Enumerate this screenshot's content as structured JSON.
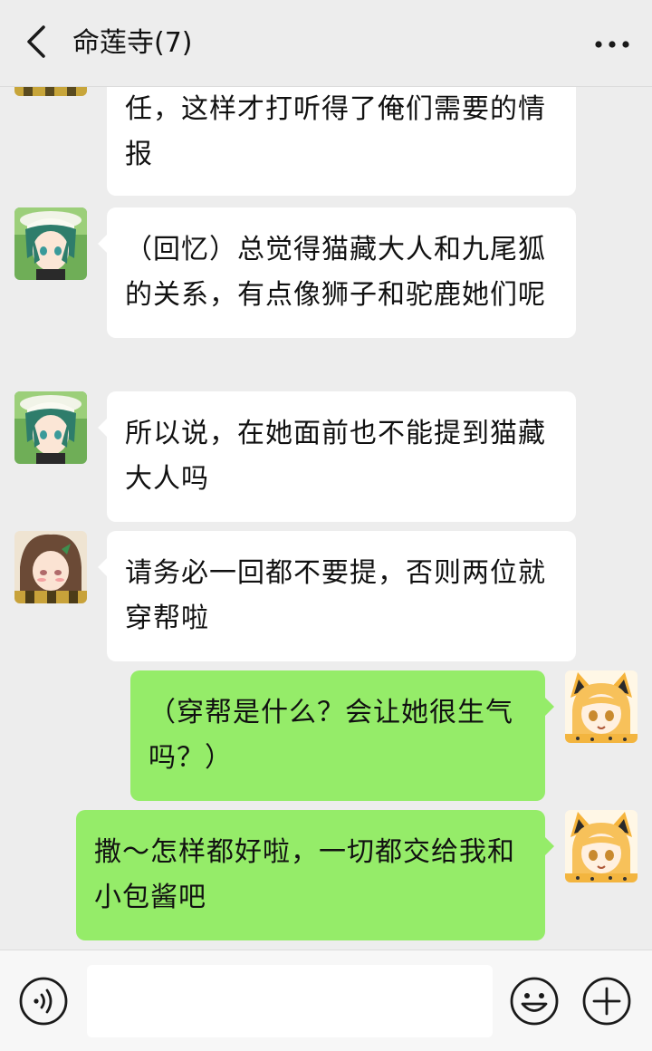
{
  "header": {
    "title": "命莲寺(7)",
    "back_icon": "chevron-left-icon",
    "more_icon": "more-dots-icon"
  },
  "messages": [
    {
      "sender": "kaban",
      "direction": "incoming",
      "text": "任，这样才打听得了俺们需要的情报"
    },
    {
      "sender": "kaban",
      "direction": "incoming",
      "text": "（回忆）总觉得猫藏大人和九尾狐的关系，有点像狮子和驼鹿她们呢"
    },
    {
      "sender": "kaban",
      "direction": "incoming",
      "text": "所以说，在她面前也不能提到猫藏大人吗"
    },
    {
      "sender": "tanuki",
      "direction": "incoming",
      "text": "请务必一回都不要提，否则两位就穿帮啦"
    },
    {
      "sender": "serval",
      "direction": "outgoing",
      "text": "（穿帮是什么？会让她很生气吗？）"
    },
    {
      "sender": "serval",
      "direction": "outgoing",
      "text": "撒～怎样都好啦，一切都交给我和小包酱吧"
    }
  ],
  "input_bar": {
    "voice_icon": "voice-icon",
    "message_value": "",
    "emoji_icon": "emoji-icon",
    "plus_icon": "plus-icon"
  },
  "colors": {
    "background": "#ededed",
    "incoming_bubble": "#ffffff",
    "outgoing_bubble": "#95ec69"
  }
}
